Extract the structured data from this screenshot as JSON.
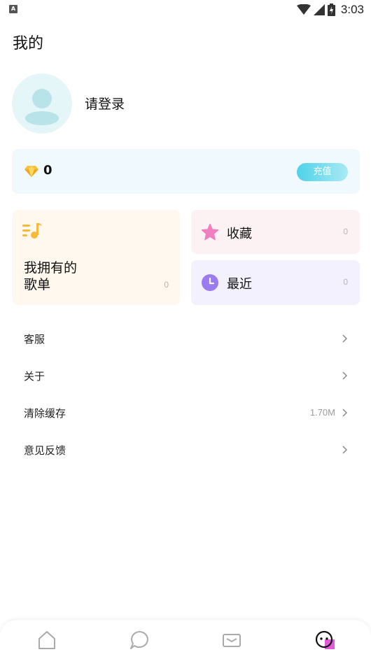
{
  "status_bar": {
    "notification_letter": "A",
    "time": "3:03",
    "icons": [
      "wifi-icon",
      "signal-icon",
      "battery-charging-icon"
    ]
  },
  "page": {
    "title": "我的"
  },
  "profile": {
    "login_text": "请登录",
    "avatar_icon": "default-avatar-icon"
  },
  "wallet": {
    "icon": "diamond-icon",
    "coins": "0",
    "recharge_label": "充值"
  },
  "cards": {
    "playlists": {
      "title": "我拥有的\n歌单",
      "count": "0",
      "icon": "music-list-icon"
    },
    "favorites": {
      "label": "收藏",
      "count": "0",
      "icon": "star-icon"
    },
    "recent": {
      "label": "最近",
      "count": "0",
      "icon": "clock-icon"
    }
  },
  "menu": [
    {
      "label": "客服",
      "value": ""
    },
    {
      "label": "关于",
      "value": ""
    },
    {
      "label": "清除缓存",
      "value": "1.70M"
    },
    {
      "label": "意见反馈",
      "value": ""
    }
  ],
  "bottom_nav": [
    {
      "icon": "home-icon",
      "active": false
    },
    {
      "icon": "chat-icon",
      "active": false
    },
    {
      "icon": "message-icon",
      "active": false
    },
    {
      "icon": "profile-icon",
      "active": true
    }
  ],
  "colors": {
    "accent": "#4fd2ea",
    "playlist_card_bg": "#fef8ef",
    "favorites_card_bg": "#fdf2f3",
    "recent_card_bg": "#f3f1fd",
    "wallet_bg": "#f0f9fd"
  }
}
